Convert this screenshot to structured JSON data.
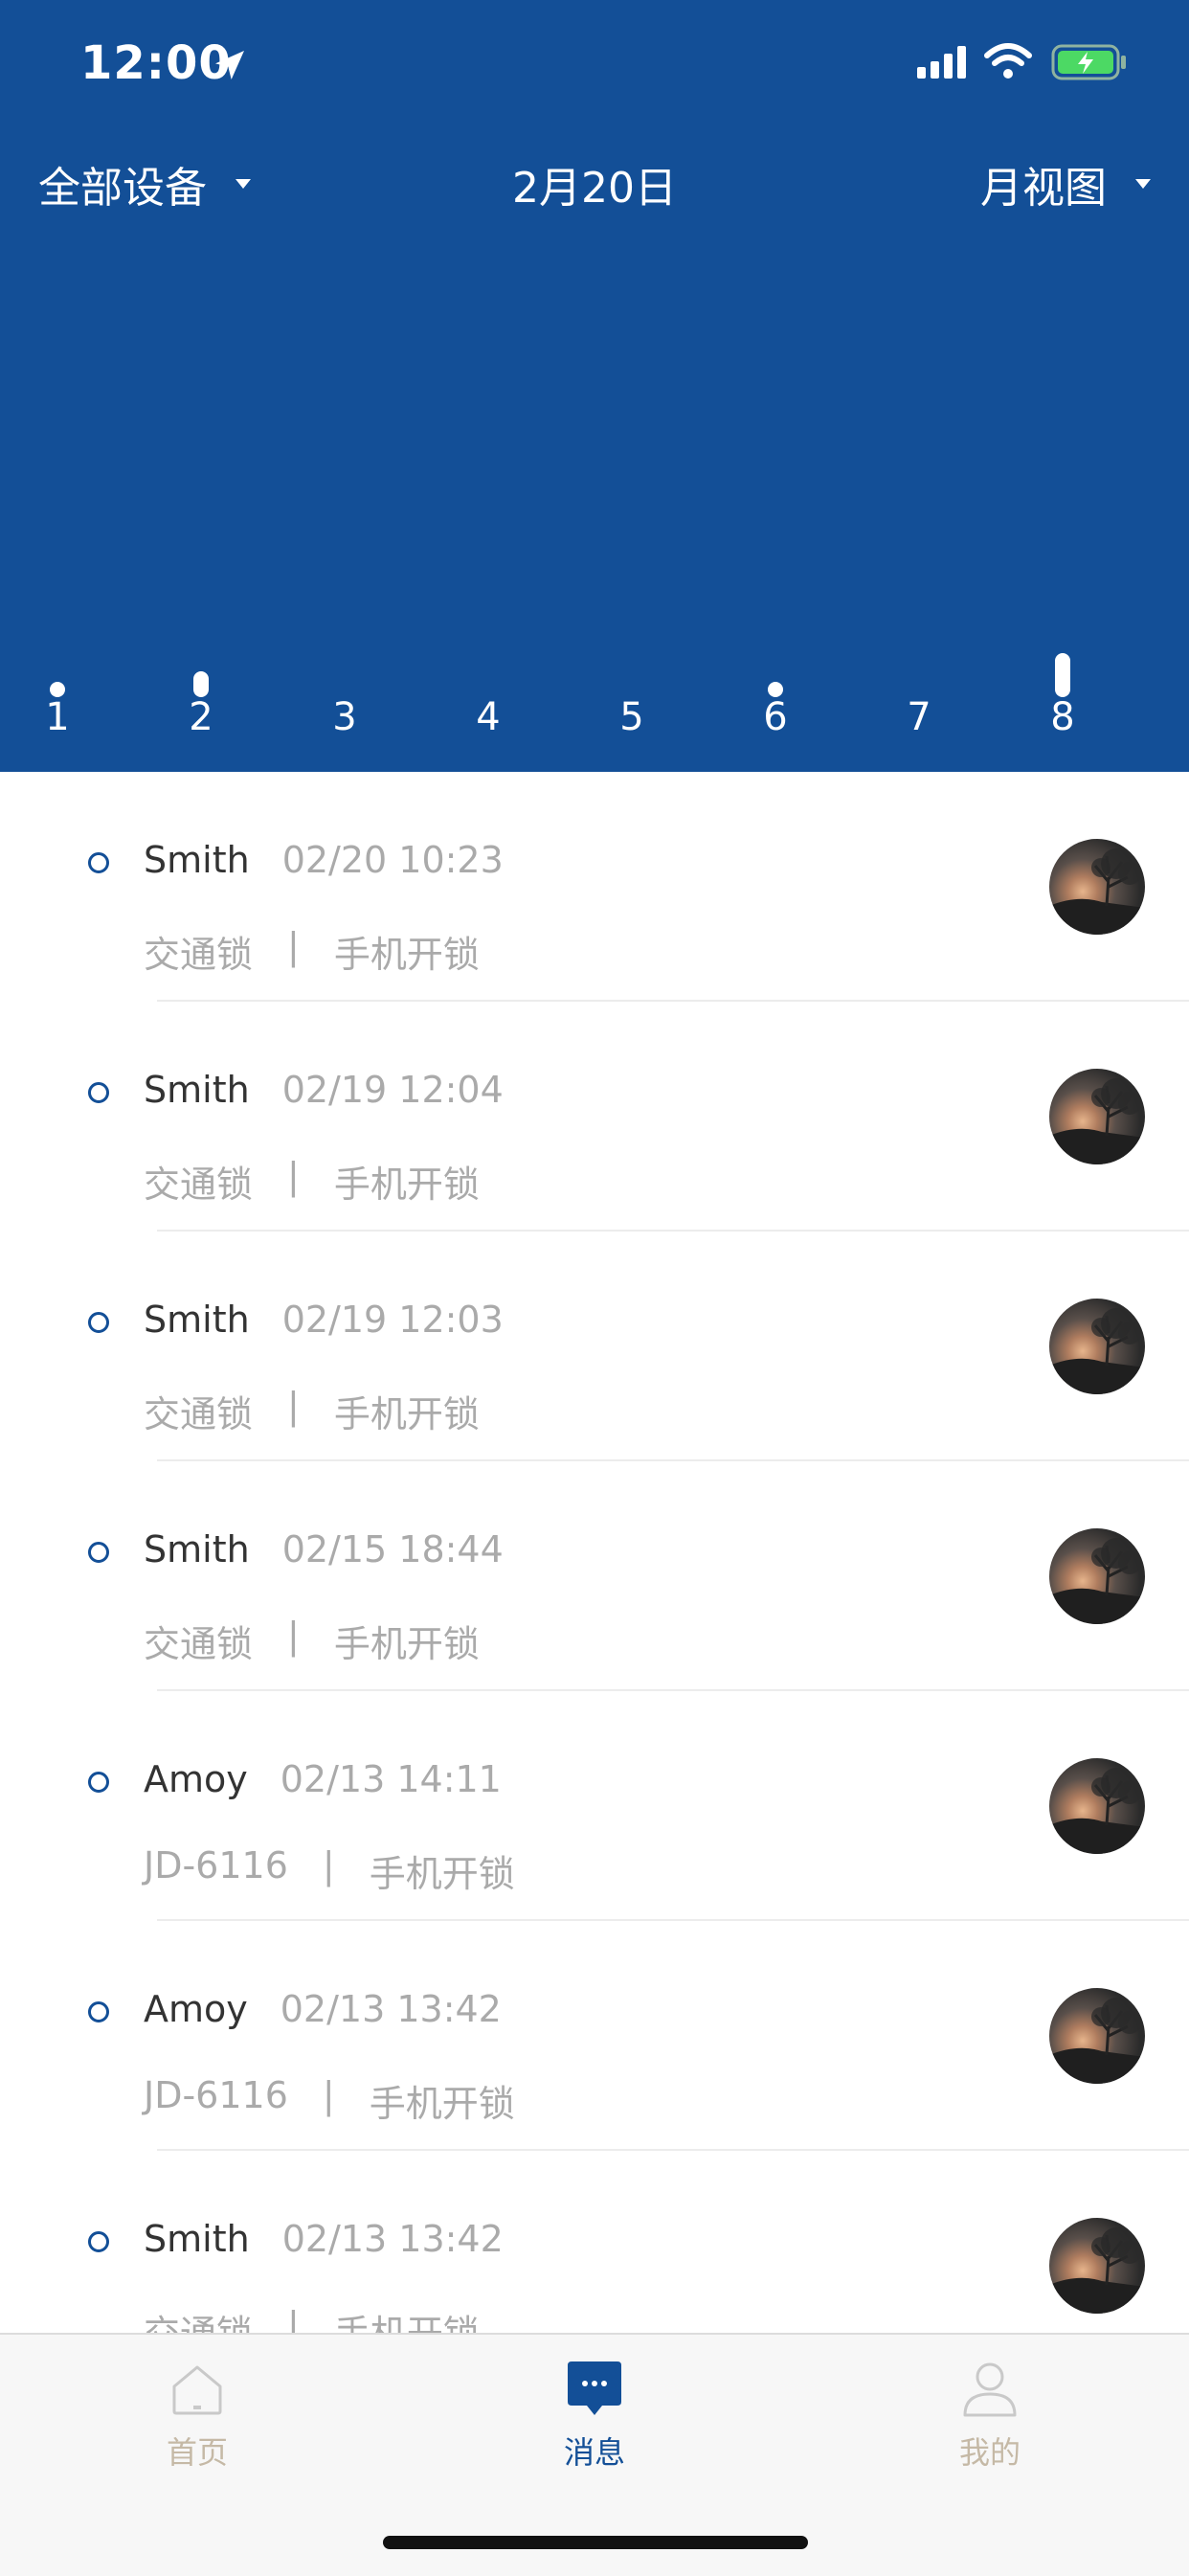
{
  "status_bar": {
    "time": "12:00"
  },
  "header": {
    "device_filter": "全部设备",
    "date_title": "2月20日",
    "view_mode": "月视图",
    "days": [
      {
        "label": "1",
        "level": 0.05
      },
      {
        "label": "2",
        "level": 0.4
      },
      {
        "label": "3",
        "level": 0
      },
      {
        "label": "4",
        "level": 0
      },
      {
        "label": "5",
        "level": 0
      },
      {
        "label": "6",
        "level": 0.05
      },
      {
        "label": "7",
        "level": 0
      },
      {
        "label": "8",
        "level": 1
      }
    ]
  },
  "records": [
    {
      "name": "Smith",
      "time": "02/20 10:23",
      "device": "交通锁",
      "separator": "|",
      "action": "手机开锁"
    },
    {
      "name": "Smith",
      "time": "02/19 12:04",
      "device": "交通锁",
      "separator": "|",
      "action": "手机开锁"
    },
    {
      "name": "Smith",
      "time": "02/19 12:03",
      "device": "交通锁",
      "separator": "|",
      "action": "手机开锁"
    },
    {
      "name": "Smith",
      "time": "02/15 18:44",
      "device": "交通锁",
      "separator": "|",
      "action": "手机开锁"
    },
    {
      "name": "Amoy",
      "time": "02/13 14:11",
      "device": "JD-6116",
      "separator": "|",
      "action": "手机开锁"
    },
    {
      "name": "Amoy",
      "time": "02/13 13:42",
      "device": "JD-6116",
      "separator": "|",
      "action": "手机开锁"
    },
    {
      "name": "Smith",
      "time": "02/13 13:42",
      "device": "交通锁",
      "separator": "|",
      "action": "手机开锁"
    }
  ],
  "tabs": [
    {
      "label": "首页",
      "icon": "home-icon",
      "color": "#C5B9A6"
    },
    {
      "label": "消息",
      "icon": "message-icon",
      "color": "#134F97"
    },
    {
      "label": "我的",
      "icon": "user-icon",
      "color": "#C5B9A6"
    }
  ],
  "colors": {
    "primary": "#134F97",
    "muted_text": "#AAAAAA",
    "tab_inactive": "#C5B9A6"
  }
}
